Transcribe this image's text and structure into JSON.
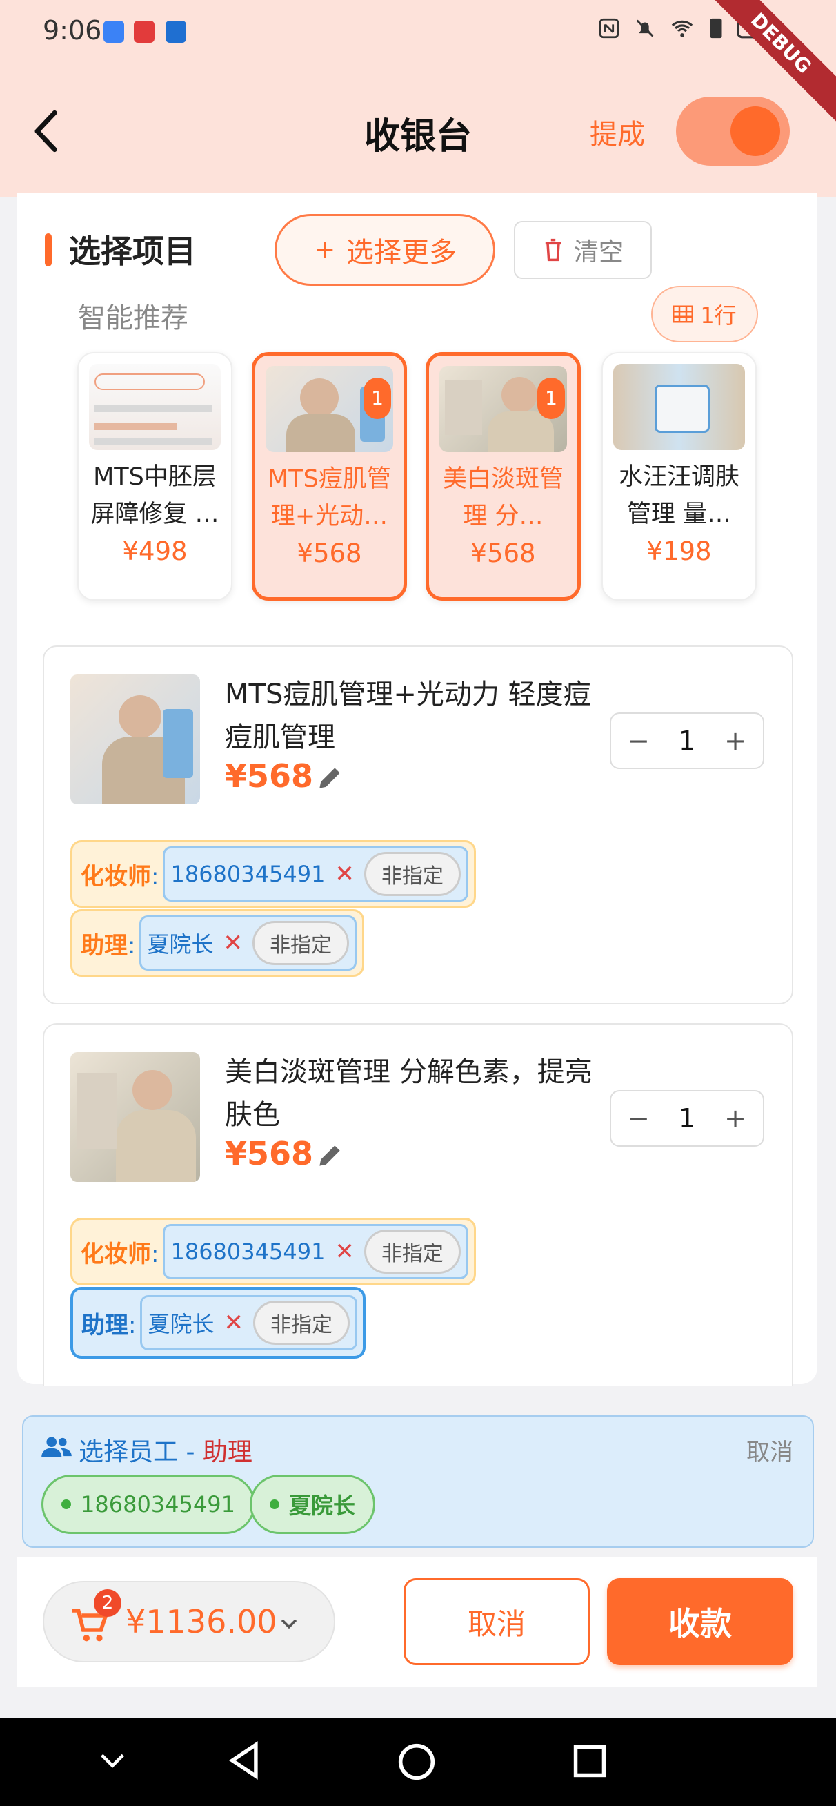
{
  "status_bar": {
    "time": "9:06",
    "debug_label": "DEBUG"
  },
  "header": {
    "title": "收银台",
    "commission_label": "提成",
    "commission_enabled": true
  },
  "section": {
    "title": "选择项目",
    "more_button": "选择更多",
    "clear_button": "清空",
    "recommend_title": "智能推荐",
    "row_toggle": "1行"
  },
  "recommendations": [
    {
      "name": "MTS中胚层屏障修复 …",
      "price": "¥498",
      "selected": false,
      "badge": ""
    },
    {
      "name": "MTS痘肌管理+光动…",
      "price": "¥568",
      "selected": true,
      "badge": "1"
    },
    {
      "name": "美白淡斑管理 分…",
      "price": "¥568",
      "selected": true,
      "badge": "1"
    },
    {
      "name": "水汪汪调肤管理 量…",
      "price": "¥198",
      "selected": false,
      "badge": ""
    }
  ],
  "items": [
    {
      "name": "MTS痘肌管理+光动力 轻度痘痘肌管理",
      "price": "¥568",
      "quantity": "1",
      "makeup_label": "化妆师",
      "makeup_staff": "18680345491",
      "assistant_label": "助理",
      "assistant_staff": "夏院长",
      "non_designated": "非指定"
    },
    {
      "name": "美白淡斑管理 分解色素，提亮肤色",
      "price": "¥568",
      "quantity": "1",
      "makeup_label": "化妆师",
      "makeup_staff": "18680345491",
      "assistant_label": "助理",
      "assistant_staff": "夏院长",
      "non_designated": "非指定"
    }
  ],
  "staff_picker": {
    "title": "选择员工",
    "separator": " - ",
    "role": "助理",
    "cancel": "取消",
    "options": [
      "18680345491",
      "夏院长"
    ]
  },
  "footer": {
    "cart_count": "2",
    "total": "¥1136.00",
    "cancel_button": "取消",
    "pay_button": "收款"
  },
  "colors": {
    "accent": "#ff6a2b",
    "header_bg": "#fde2da",
    "staff_blue": "#1e73c8",
    "green": "#3fae3f"
  }
}
